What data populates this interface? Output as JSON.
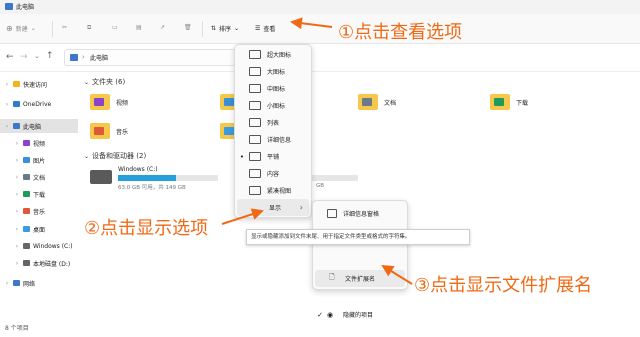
{
  "window": {
    "title": "此电脑"
  },
  "toolbar": {
    "new_label": "新建",
    "sort_label": "排序",
    "view_label": "查看",
    "more_label": "···"
  },
  "address": {
    "path": "此电脑"
  },
  "sidebar": {
    "items": [
      {
        "label": "快速访问",
        "icon": "star-icon",
        "color": "#f3b51d"
      },
      {
        "label": "OneDrive",
        "icon": "cloud-icon",
        "color": "#2b7cd3"
      },
      {
        "label": "此电脑",
        "icon": "monitor-icon",
        "color": "#3b78c9"
      },
      {
        "label": "视频",
        "icon": "video-icon",
        "color": "#8b44c9"
      },
      {
        "label": "图片",
        "icon": "image-icon",
        "color": "#3a8fd8"
      },
      {
        "label": "文档",
        "icon": "document-icon",
        "color": "#6a7a8c"
      },
      {
        "label": "下载",
        "icon": "download-icon",
        "color": "#1e9b5c"
      },
      {
        "label": "音乐",
        "icon": "music-icon",
        "color": "#e0583a"
      },
      {
        "label": "桌面",
        "icon": "desktop-icon",
        "color": "#3b9be0"
      },
      {
        "label": "Windows (C:)",
        "icon": "drive-icon",
        "color": "#666666"
      },
      {
        "label": "本地磁盘 (D:)",
        "icon": "drive-icon",
        "color": "#666666"
      },
      {
        "label": "网络",
        "icon": "network-icon",
        "color": "#3b78c9"
      }
    ]
  },
  "main": {
    "folders_section": "文件夹 (6)",
    "folders": [
      {
        "label": "视频",
        "color": "#8b44c9"
      },
      {
        "label": "音乐",
        "color": "#e0583a"
      },
      {
        "label": "文档",
        "color": "#6a7a8c"
      },
      {
        "label": "下载",
        "color": "#1e9b5c"
      }
    ],
    "drives_section": "设备和驱动器 (2)",
    "drives": [
      {
        "name": "Windows (C:)",
        "free": "63.0 GB 可用，共 149 GB",
        "used_fraction": 0.58
      },
      {
        "partial_text": "GB"
      }
    ]
  },
  "view_menu": {
    "items": [
      {
        "label": "超大图标",
        "checked": false
      },
      {
        "label": "大图标",
        "checked": false
      },
      {
        "label": "中图标",
        "checked": false
      },
      {
        "label": "小图标",
        "checked": false
      },
      {
        "label": "列表",
        "checked": false
      },
      {
        "label": "详细信息",
        "checked": false
      },
      {
        "label": "平铺",
        "checked": true
      },
      {
        "label": "内容",
        "checked": false
      },
      {
        "label": "紧凑视图",
        "checked": false
      },
      {
        "label": "显示",
        "checked": false
      }
    ]
  },
  "show_menu": {
    "items": [
      {
        "label": "详细信息窗格",
        "checked": false
      },
      {
        "label": "文件扩展名",
        "checked": false
      },
      {
        "label": "隐藏的项目",
        "checked": true
      }
    ],
    "tooltip": "显示或隐藏添加到文件末尾、用于指定文件类型或格式的字符集。"
  },
  "annotations": {
    "step1": "①点击查看选项",
    "step2": "②点击显示选项",
    "step3": "③点击显示文件扩展名",
    "color": "#ef6a16"
  },
  "status": {
    "count": "8 个项目"
  }
}
